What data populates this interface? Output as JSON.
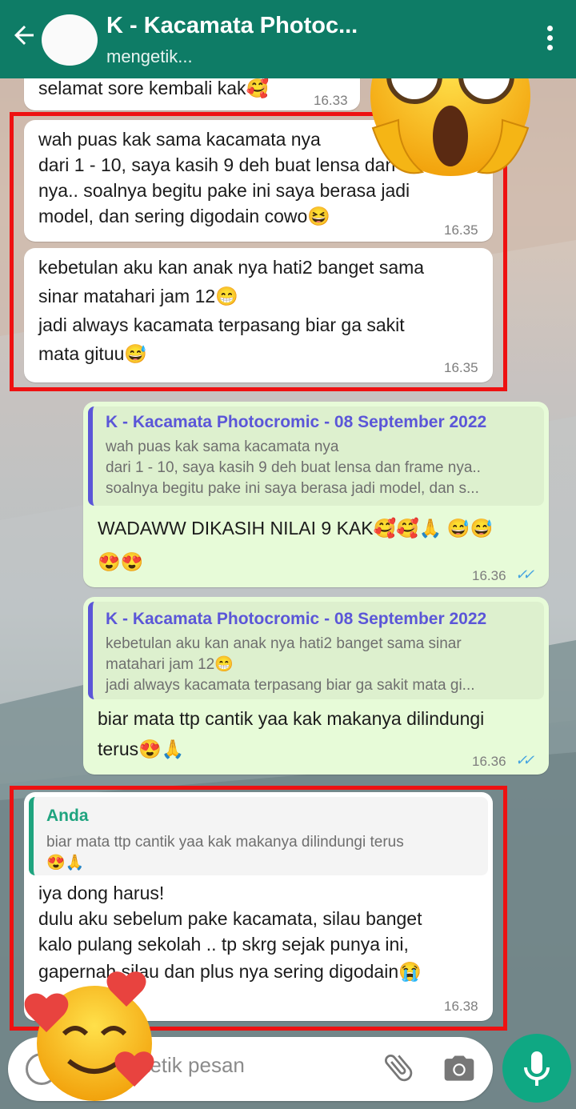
{
  "header": {
    "title": "K - Kacamata Photoc...",
    "status": "mengetik...",
    "colors": {
      "bar": "#0e7c66"
    }
  },
  "messages": {
    "m0": {
      "text": "selamat sore kembali kak🥰",
      "time": "16.33"
    },
    "m1": {
      "lines": [
        "wah puas kak sama kacamata nya",
        "dari 1 - 10, saya kasih 9 deh buat lensa dan frame",
        "nya.. soalnya begitu pake ini saya berasa jadi",
        "model, dan sering digodain cowo😆"
      ],
      "time": "16.35"
    },
    "m2": {
      "lines": [
        "kebetulan aku kan anak nya hati2 banget sama",
        "sinar matahari jam 12😁",
        "jadi always kacamata terpasang biar ga sakit",
        "mata gituu😅"
      ],
      "time": "16.35"
    },
    "m3": {
      "quote_name": "K - Kacamata Photocromic - 08 September 2022",
      "quote_lines": [
        "wah puas kak sama kacamata nya",
        "dari 1 - 10, saya kasih 9 deh buat lensa dan frame nya..",
        "soalnya begitu pake ini saya berasa jadi model, dan s..."
      ],
      "lines": [
        "WADAWW DIKASIH NILAI 9 KAK🥰🥰🙏 😅😅",
        "😍😍"
      ],
      "time": "16.36",
      "status_icon": "double-check-icon"
    },
    "m4": {
      "quote_name": "K - Kacamata Photocromic - 08 September 2022",
      "quote_lines": [
        "kebetulan aku kan anak nya hati2 banget sama sinar",
        "matahari jam 12😁",
        "jadi always kacamata terpasang biar ga sakit mata gi..."
      ],
      "lines": [
        "biar mata ttp cantik yaa kak makanya dilindungi",
        "terus😍🙏"
      ],
      "time": "16.36",
      "status_icon": "double-check-icon"
    },
    "m5": {
      "quote_name": "Anda",
      "quote_lines": [
        "biar mata ttp cantik yaa kak makanya dilindungi terus",
        "😍🙏"
      ],
      "lines": [
        "iya dong harus!",
        "dulu aku sebelum pake kacamata, silau banget",
        "kalo pulang sekolah .. tp skrg sejak punya ini,",
        "gapernah silau dan plus nya sering digodain😭"
      ],
      "time": "16.38"
    }
  },
  "input": {
    "placeholder": "Ketik pesan"
  },
  "stickers": {
    "top": "shocked-face-emoji",
    "bottom": "smiling-face-with-hearts-emoji"
  }
}
